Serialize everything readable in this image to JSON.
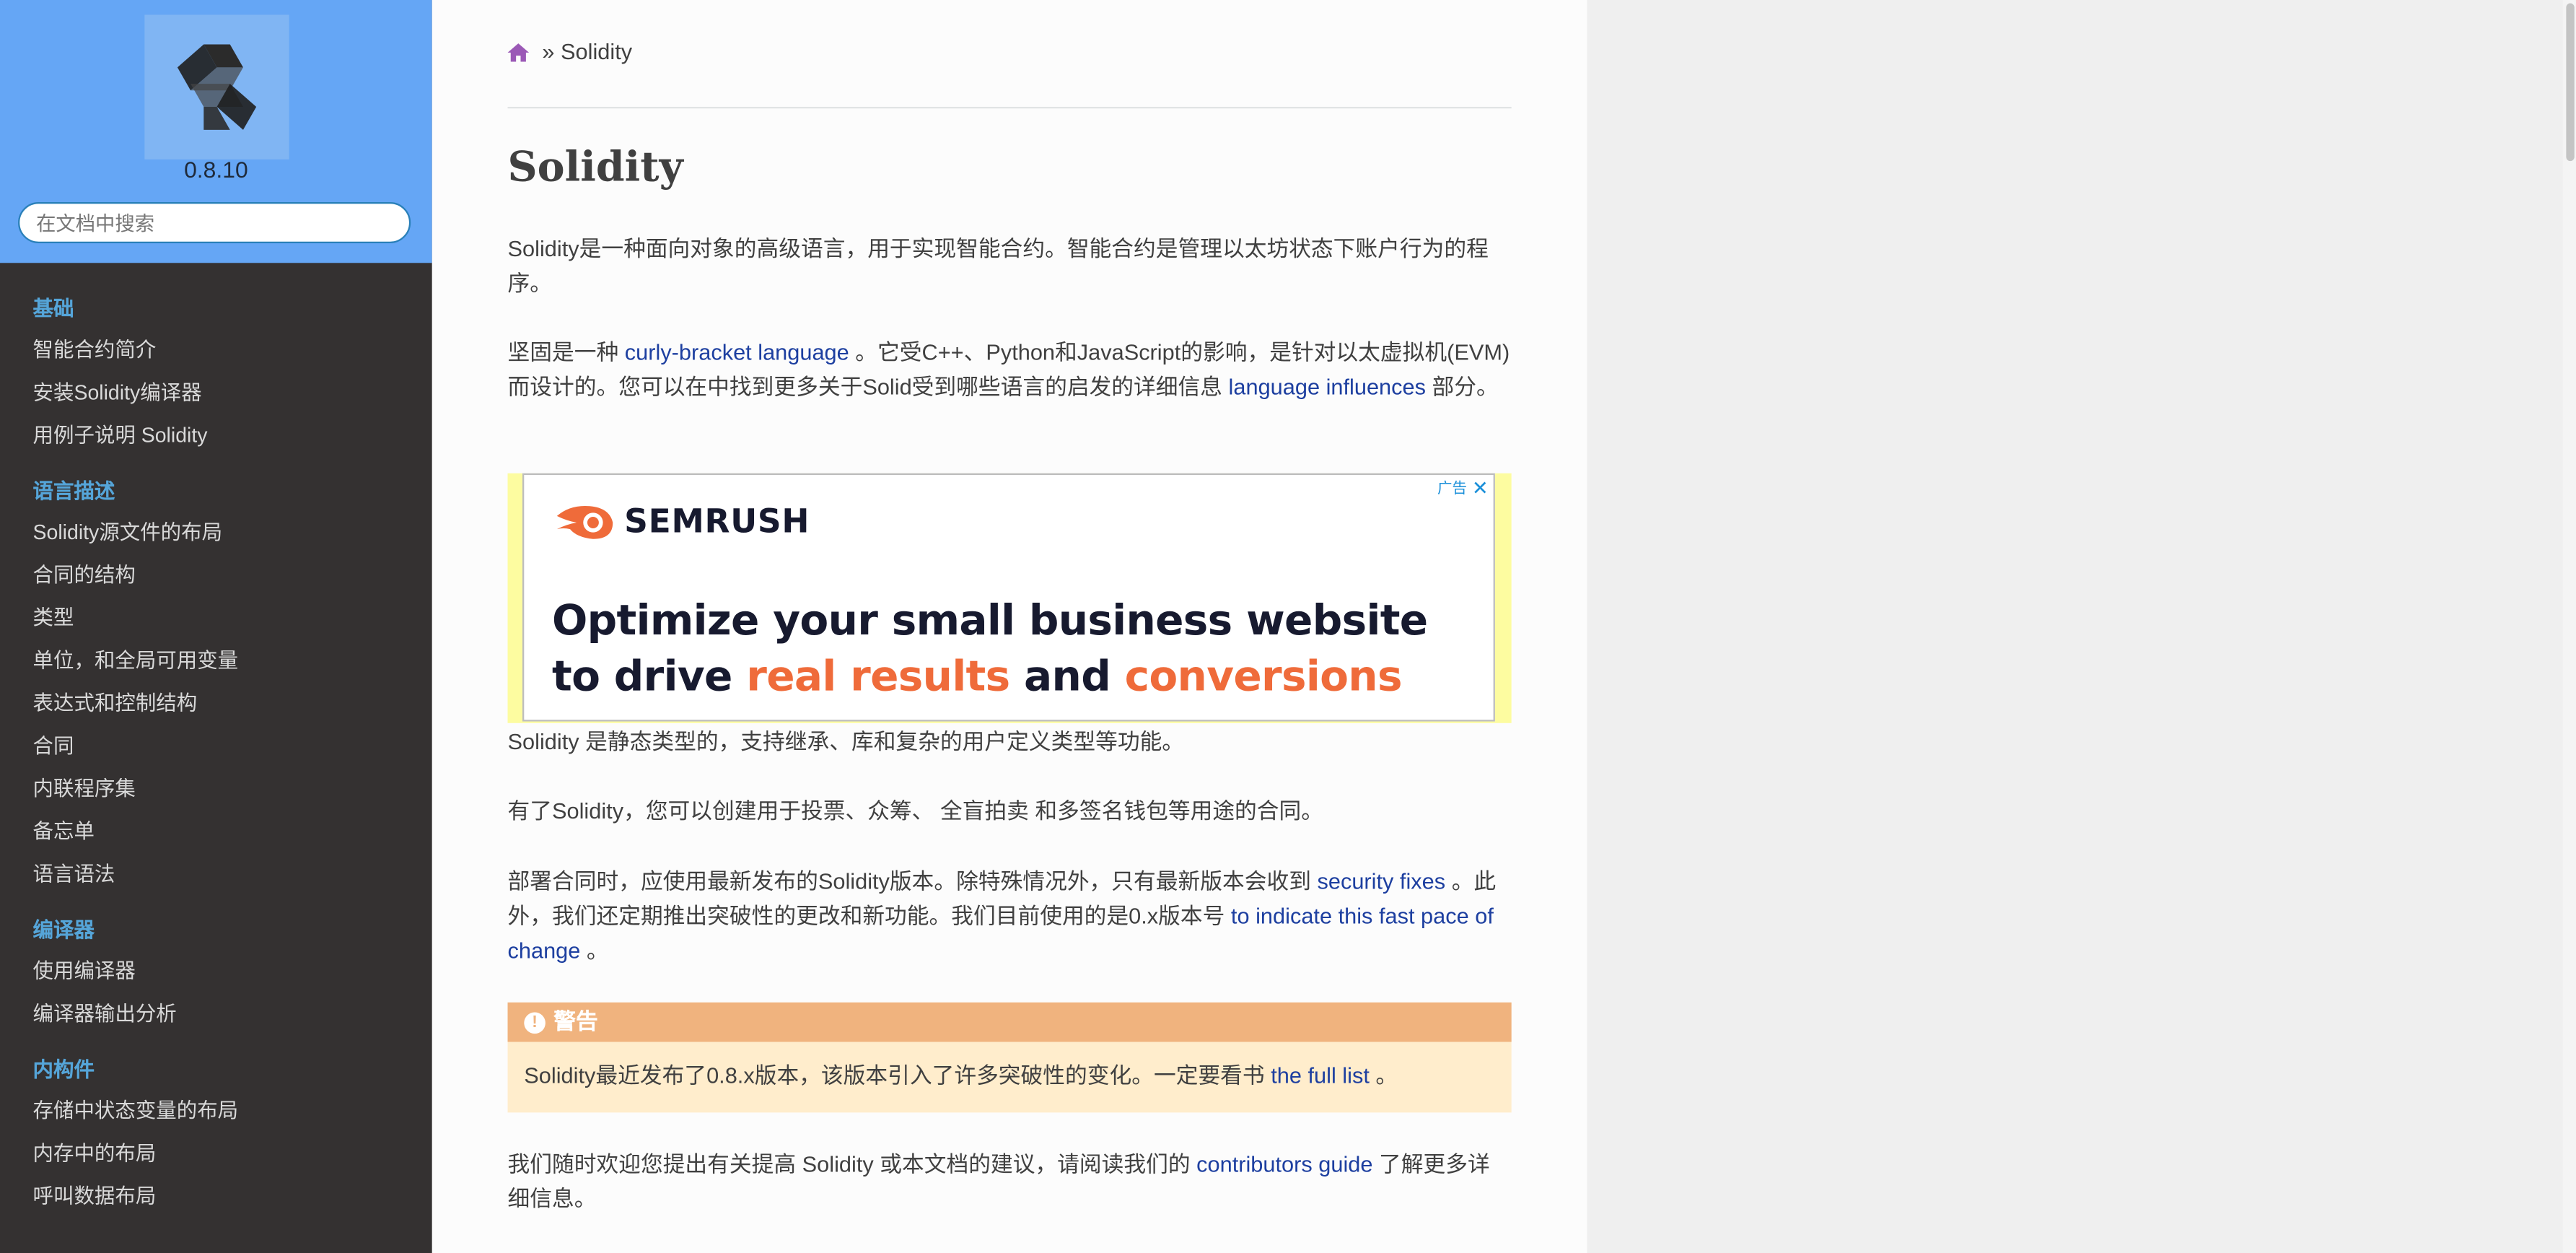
{
  "sidebar": {
    "version": "0.8.10",
    "search_placeholder": "在文档中搜索",
    "sections": [
      {
        "caption": "基础",
        "items": [
          "智能合约简介",
          "安装Solidity编译器",
          "用例子说明 Solidity"
        ]
      },
      {
        "caption": "语言描述",
        "items": [
          "Solidity源文件的布局",
          "合同的结构",
          "类型",
          "单位，和全局可用变量",
          "表达式和控制结构",
          "合同",
          "内联程序集",
          "备忘单",
          "语言语法"
        ]
      },
      {
        "caption": "编译器",
        "items": [
          "使用编译器",
          "编译器输出分析"
        ]
      },
      {
        "caption": "内构件",
        "items": [
          "存储中状态变量的布局",
          "内存中的布局",
          "呼叫数据布局"
        ]
      }
    ]
  },
  "breadcrumb": {
    "separator": "»",
    "current": "Solidity"
  },
  "page": {
    "title": "Solidity",
    "p1": "Solidity是一种面向对象的高级语言，用于实现智能合约。智能合约是管理以太坊状态下账户行为的程序。",
    "p2_before": "坚固是一种 ",
    "p2_link1": "curly-bracket language",
    "p2_middle": " 。它受C++、Python和JavaScript的影响，是针对以太虚拟机(EVM)而设计的。您可以在中找到更多关于Solid受到哪些语言的启发的详细信息 ",
    "p2_link2": "language influences",
    "p2_after": " 部分。",
    "p3": "Solidity 是静态类型的，支持继承、库和复杂的用户定义类型等功能。",
    "p4": "有了Solidity，您可以创建用于投票、众筹、 全盲拍卖 和多签名钱包等用途的合同。",
    "p5_before": "部署合同时，应使用最新发布的Solidity版本。除特殊情况外，只有最新版本会收到 ",
    "p5_link1": "security fixes",
    "p5_middle": " 。此外，我们还定期推出突破性的更改和新功能。我们目前使用的是0.x版本号 ",
    "p5_link2": "to indicate this fast pace of change",
    "p5_after": " 。",
    "p6_before": "我们随时欢迎您提出有关提高 Solidity 或本文档的建议，请阅读我们的 ",
    "p6_link": "contributors guide",
    "p6_after": " 了解更多详细信息。"
  },
  "warning": {
    "title": "警告",
    "body_before": "Solidity最近发布了0.8.x版本，该版本引入了许多突破性的变化。一定要看书 ",
    "body_link": "the full list",
    "body_after": " 。"
  },
  "ad": {
    "tag": "广告",
    "brand": "SEMRUSH",
    "line1": "Optimize your small business website",
    "line2_a": "to drive ",
    "line2_b": "real results",
    "line2_c": " and ",
    "line2_d": "conversions"
  },
  "colors": {
    "sidebar_top": "#65a6f5",
    "sidebar_bg": "#343131",
    "nav_caption": "#55a5d9",
    "link": "#1d3fa0",
    "warning_title": "#f0b37e",
    "warning_bg": "#ffedcc",
    "ad_accent": "#ef6b3a"
  }
}
